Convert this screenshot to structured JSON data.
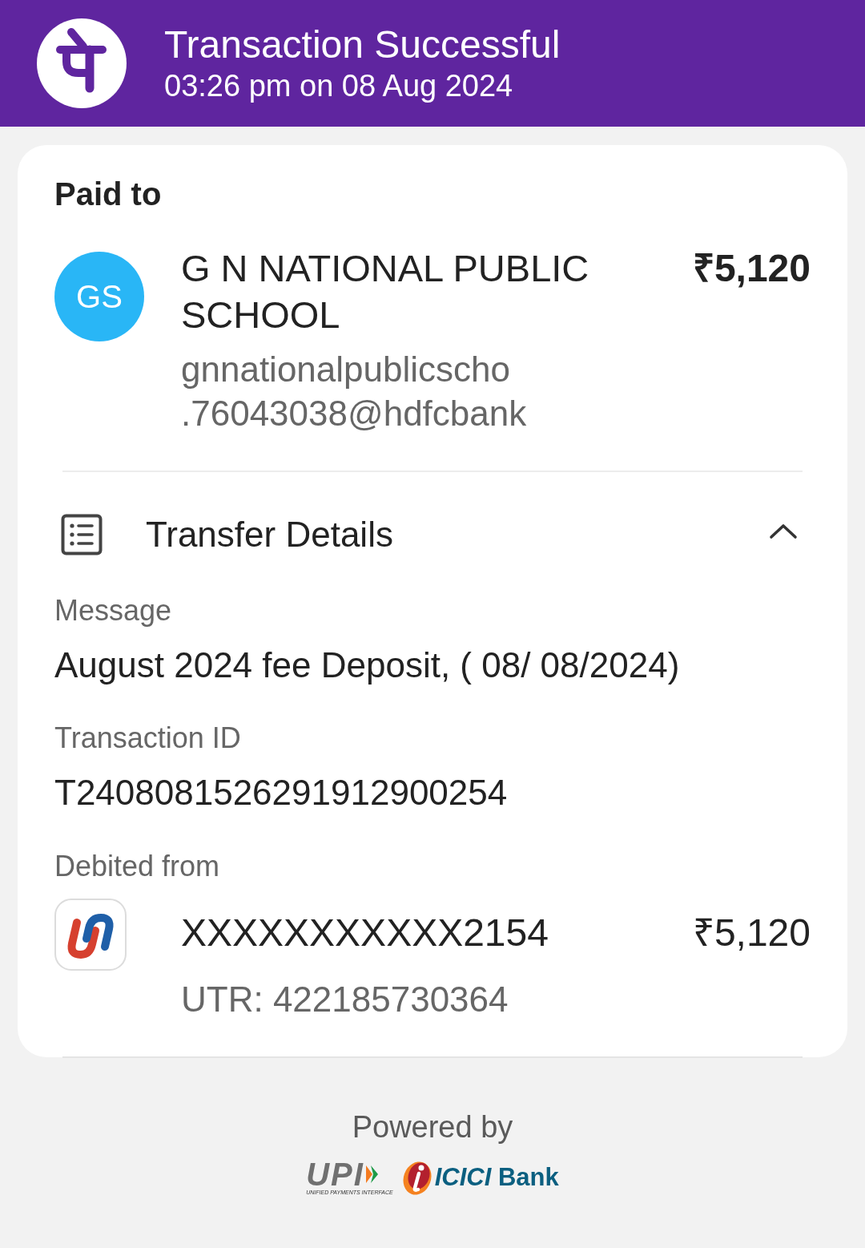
{
  "header": {
    "title": "Transaction Successful",
    "subtitle": "03:26 pm on 08 Aug 2024"
  },
  "paid_to": {
    "heading": "Paid to",
    "avatar_initials": "GS",
    "name": "G N NATIONAL PUBLIC SCHOOL",
    "amount": "₹5,120",
    "upi_id_lines": [
      "gnnationalpublicscho",
      ".76043038@hdfcbank"
    ]
  },
  "transfer_details": {
    "title": "Transfer Details",
    "expanded": true,
    "fields": [
      {
        "label": "Message",
        "value": "August 2024 fee Deposit, ( 08/ 08/2024)"
      },
      {
        "label": "Transaction ID",
        "value": "T2408081526291912900254"
      }
    ],
    "debited_from": {
      "label": "Debited from",
      "account": "XXXXXXXXXXX2154",
      "amount": "₹5,120",
      "utr": "UTR: 422185730364"
    }
  },
  "footer": {
    "powered_by": "Powered by",
    "upi_logo": {
      "text": "UPI",
      "tagline": "UNIFIED PAYMENTS INTERFACE"
    },
    "bank_logo": {
      "text": "*ICICI* Bank"
    }
  }
}
